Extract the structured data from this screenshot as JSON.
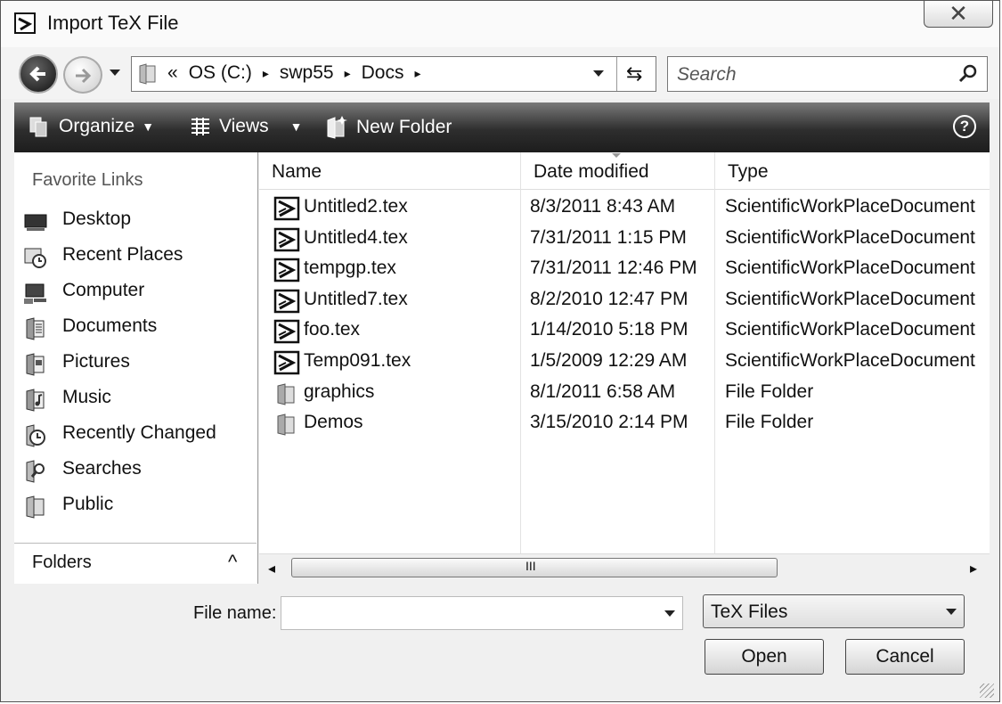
{
  "window": {
    "title": "Import TeX File",
    "close_label": "✕"
  },
  "nav": {
    "breadcrumbs": [
      "«",
      "OS (C:)",
      "▸",
      "swp55",
      "▸",
      "Docs",
      "▸"
    ],
    "search_placeholder": "Search"
  },
  "toolbar": {
    "organize": "Organize",
    "views": "Views",
    "new_folder": "New Folder",
    "help": "?"
  },
  "sidebar": {
    "title": "Favorite Links",
    "items": [
      {
        "label": "Desktop",
        "icon": "desktop-icon"
      },
      {
        "label": "Recent Places",
        "icon": "recent-places-icon"
      },
      {
        "label": "Computer",
        "icon": "computer-icon"
      },
      {
        "label": "Documents",
        "icon": "documents-icon"
      },
      {
        "label": "Pictures",
        "icon": "pictures-icon"
      },
      {
        "label": "Music",
        "icon": "music-icon"
      },
      {
        "label": "Recently Changed",
        "icon": "recently-changed-icon"
      },
      {
        "label": "Searches",
        "icon": "searches-icon"
      },
      {
        "label": "Public",
        "icon": "public-folder-icon"
      }
    ],
    "folders_label": "Folders",
    "folders_caret": "^"
  },
  "columns": {
    "name": "Name",
    "date": "Date modified",
    "type": "Type"
  },
  "files": [
    {
      "name": "Untitled2.tex",
      "date": "8/3/2011 8:43 AM",
      "type": "ScientificWorkPlaceDocument",
      "icon": "tex-file-icon"
    },
    {
      "name": "Untitled4.tex",
      "date": "7/31/2011 1:15 PM",
      "type": "ScientificWorkPlaceDocument",
      "icon": "tex-file-icon"
    },
    {
      "name": "tempgp.tex",
      "date": "7/31/2011 12:46 PM",
      "type": "ScientificWorkPlaceDocument",
      "icon": "tex-file-icon"
    },
    {
      "name": "Untitled7.tex",
      "date": "8/2/2010 12:47 PM",
      "type": "ScientificWorkPlaceDocument",
      "icon": "tex-file-icon"
    },
    {
      "name": "foo.tex",
      "date": "1/14/2010 5:18 PM",
      "type": "ScientificWorkPlaceDocument",
      "icon": "tex-file-icon"
    },
    {
      "name": "Temp091.tex",
      "date": "1/5/2009 12:29 AM",
      "type": "ScientificWorkPlaceDocument",
      "icon": "tex-file-icon"
    },
    {
      "name": "graphics",
      "date": "8/1/2011 6:58 AM",
      "type": "File Folder",
      "icon": "folder-icon"
    },
    {
      "name": "Demos",
      "date": "3/15/2010 2:14 PM",
      "type": "File Folder",
      "icon": "folder-icon"
    }
  ],
  "scrollbar": {
    "grip": "III"
  },
  "footer": {
    "file_name_label": "File name:",
    "file_name_value": "",
    "file_type": "TeX Files",
    "open": "Open",
    "cancel": "Cancel"
  }
}
